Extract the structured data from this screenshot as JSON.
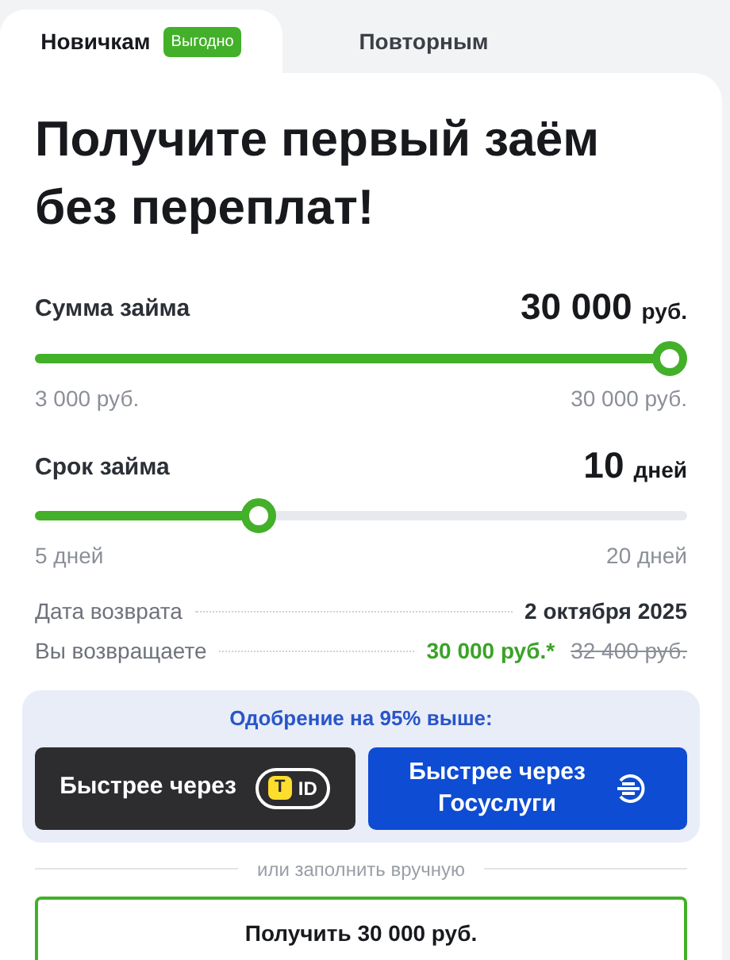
{
  "tabs": [
    {
      "label": "Новичкам",
      "badge": "Выгодно",
      "selected": true
    },
    {
      "label": "Повторным",
      "selected": false
    }
  ],
  "title": "Получите первый заём\nбез переплат!",
  "sliders": [
    {
      "label": "Сумма займа",
      "value": "30 000",
      "unit": "руб.",
      "level": 1,
      "min": "3 000 руб.",
      "max": "30 000 руб."
    },
    {
      "label": "Срок займа",
      "value": "10",
      "unit": "дней",
      "level": 0.333,
      "min": "5 дней",
      "max": "20 дней"
    }
  ],
  "summary": [
    {
      "label": "Дата возврата",
      "value": "2 октября 2025"
    },
    {
      "label": "Вы возвращаете",
      "value": "30 000 руб.*",
      "old_value": "32 400 руб."
    }
  ],
  "fast": {
    "heading": "Одобрение на 95% выше:",
    "tid_button": {
      "label": "Быстрее через",
      "mark": "T",
      "text": "ID"
    },
    "gos_button": {
      "label": "Быстрее через\nГосуслуги"
    }
  },
  "divider_text": "или заполнить вручную",
  "submit": "Получить 30 000 руб."
}
